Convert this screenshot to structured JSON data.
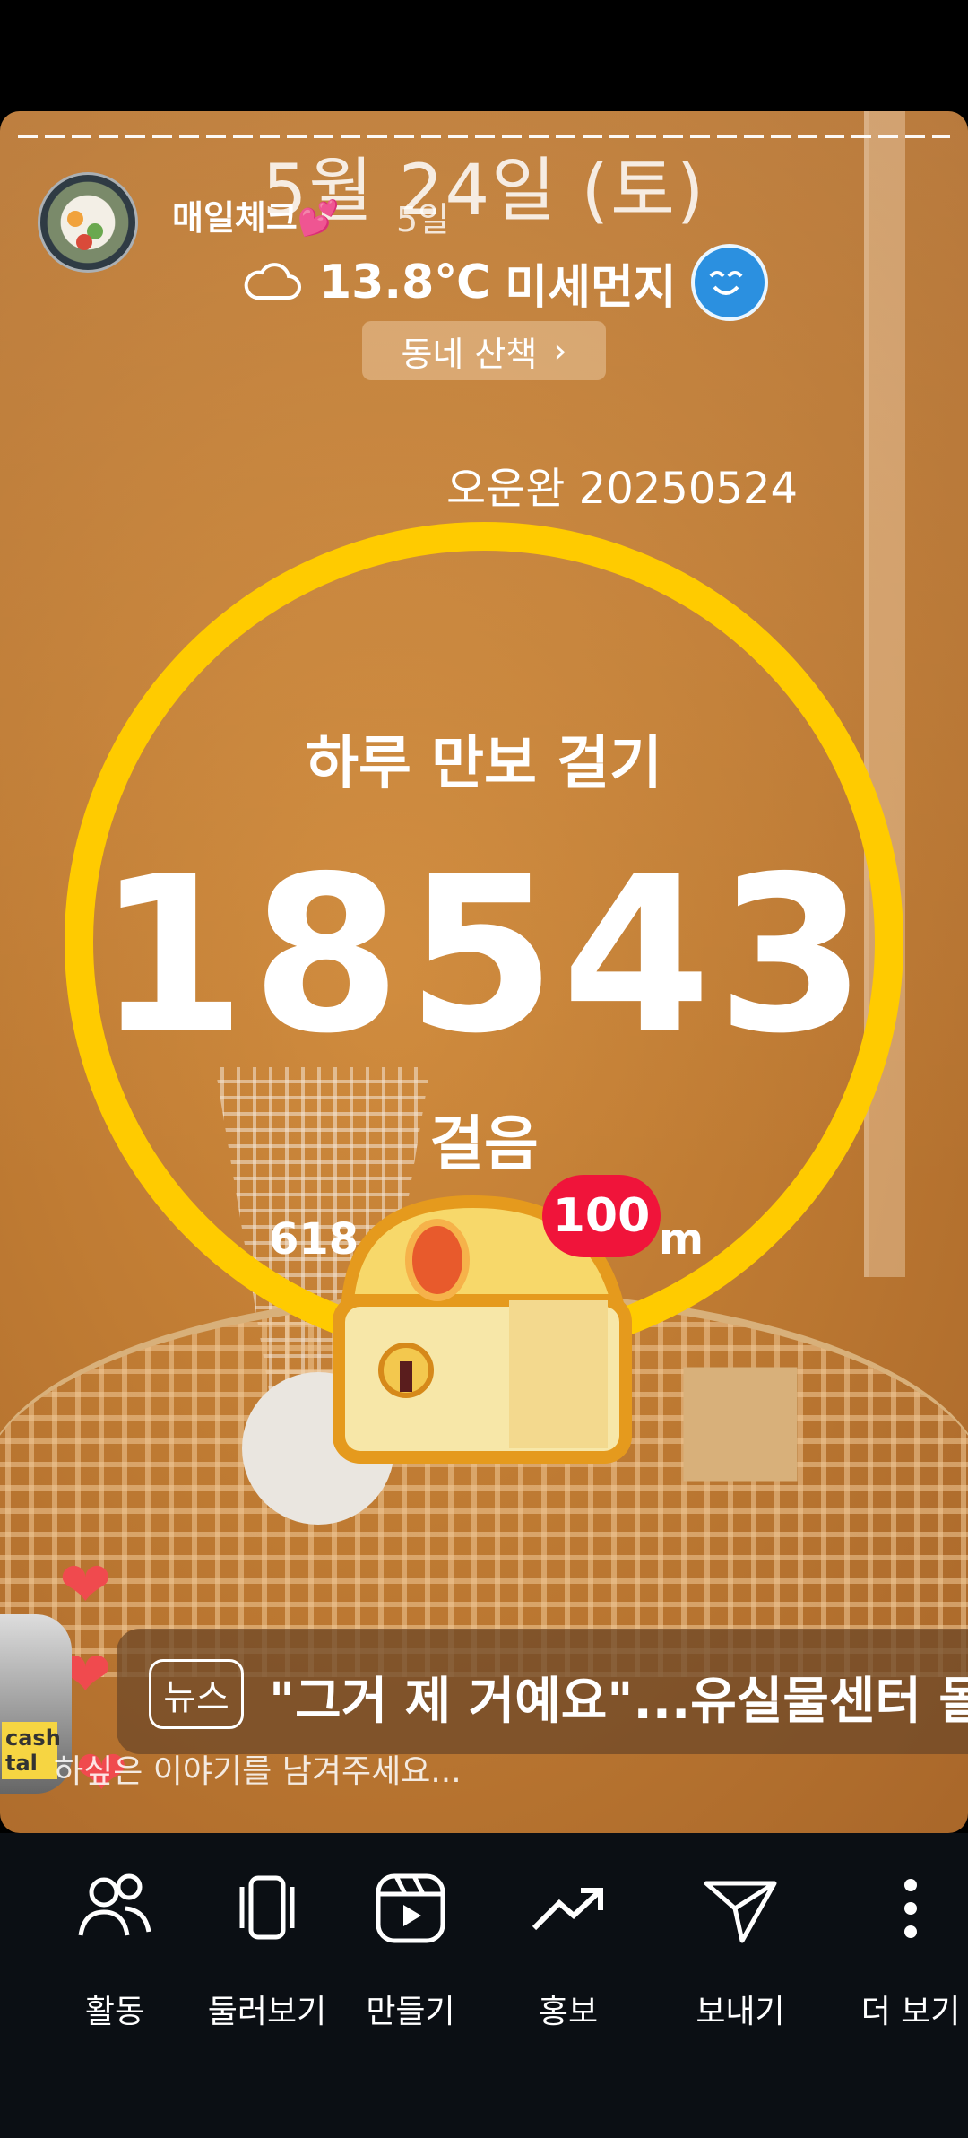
{
  "story": {
    "username": "매일체크💕",
    "age": "5일",
    "date": "5월 24일 (토)",
    "weather": {
      "temp": "13.8℃",
      "air": "미세먼지"
    },
    "pill": {
      "label": "동네 산책",
      "chevron": "›"
    },
    "caption": "오운완 20250524",
    "walk": {
      "title": "하루 만보 걸기",
      "steps": "18543",
      "unit": "걸음",
      "dist_left": "618",
      "dist_right": "m"
    },
    "chest_badge": "100",
    "news": {
      "tag": "뉴스",
      "headline": "\"그거 제 거예요\"...유실물센터 몰"
    },
    "cash_label": "cash tal",
    "comment_prefix": "하",
    "comment_placeholder": "싶은 이야기를 남겨주세요...",
    "colors": {
      "ring": "#ffcb00",
      "badge": "#f0143a",
      "heart": "#f04a4e"
    }
  },
  "bottom_nav": [
    {
      "label": "활동",
      "icon": "people-icon"
    },
    {
      "label": "둘러보기",
      "icon": "swipe-cards-icon"
    },
    {
      "label": "만들기",
      "icon": "reel-play-icon"
    },
    {
      "label": "홍보",
      "icon": "trend-up-icon"
    },
    {
      "label": "보내기",
      "icon": "send-icon"
    },
    {
      "label": "더 보기",
      "icon": "more-vertical-icon"
    }
  ]
}
